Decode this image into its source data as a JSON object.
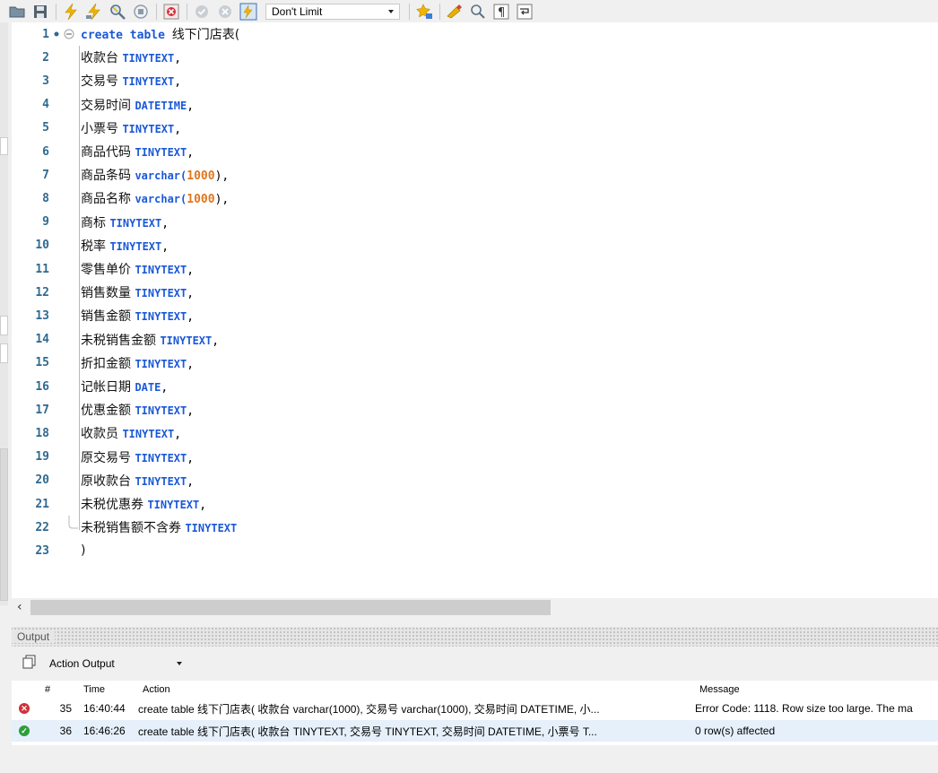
{
  "toolbar": {
    "limit_value": "Don't Limit",
    "icons": [
      "open-folder-icon",
      "save-icon",
      "execute-icon",
      "execute-current-icon",
      "explain-icon",
      "stop-icon",
      "toggle-error-icon",
      "commit-icon",
      "rollback-icon",
      "autocommit-icon",
      "beautify-icon",
      "snippet-icon",
      "find-icon",
      "invisible-chars-icon",
      "wrap-icon"
    ]
  },
  "editor": {
    "lines": [
      {
        "n": "1",
        "kw": "create table ",
        "id": "线下门店表(",
        "type": "",
        "num": "",
        "tail": ""
      },
      {
        "n": "2",
        "kw": "",
        "id": "收款台 ",
        "type": "TINYTEXT",
        "num": "",
        "tail": ","
      },
      {
        "n": "3",
        "kw": "",
        "id": "交易号 ",
        "type": "TINYTEXT",
        "num": "",
        "tail": ","
      },
      {
        "n": "4",
        "kw": "",
        "id": "交易时间 ",
        "type": "DATETIME",
        "num": "",
        "tail": ","
      },
      {
        "n": "5",
        "kw": "",
        "id": "小票号 ",
        "type": "TINYTEXT",
        "num": "",
        "tail": ","
      },
      {
        "n": "6",
        "kw": "",
        "id": "商品代码 ",
        "type": "TINYTEXT",
        "num": "",
        "tail": ","
      },
      {
        "n": "7",
        "kw": "",
        "id": "商品条码 ",
        "type": "varchar(",
        "num": "1000",
        "tail": "),"
      },
      {
        "n": "8",
        "kw": "",
        "id": "商品名称 ",
        "type": "varchar(",
        "num": "1000",
        "tail": "),"
      },
      {
        "n": "9",
        "kw": "",
        "id": "商标 ",
        "type": "TINYTEXT",
        "num": "",
        "tail": ","
      },
      {
        "n": "10",
        "kw": "",
        "id": "税率 ",
        "type": "TINYTEXT",
        "num": "",
        "tail": ","
      },
      {
        "n": "11",
        "kw": "",
        "id": "零售单价 ",
        "type": "TINYTEXT",
        "num": "",
        "tail": ","
      },
      {
        "n": "12",
        "kw": "",
        "id": "销售数量 ",
        "type": "TINYTEXT",
        "num": "",
        "tail": ","
      },
      {
        "n": "13",
        "kw": "",
        "id": "销售金额 ",
        "type": "TINYTEXT",
        "num": "",
        "tail": ","
      },
      {
        "n": "14",
        "kw": "",
        "id": "未税销售金额 ",
        "type": "TINYTEXT",
        "num": "",
        "tail": ","
      },
      {
        "n": "15",
        "kw": "",
        "id": "折扣金额 ",
        "type": "TINYTEXT",
        "num": "",
        "tail": ","
      },
      {
        "n": "16",
        "kw": "",
        "id": "记帐日期 ",
        "type": "DATE",
        "num": "",
        "tail": ","
      },
      {
        "n": "17",
        "kw": "",
        "id": "优惠金额 ",
        "type": "TINYTEXT",
        "num": "",
        "tail": ","
      },
      {
        "n": "18",
        "kw": "",
        "id": "收款员 ",
        "type": "TINYTEXT",
        "num": "",
        "tail": ","
      },
      {
        "n": "19",
        "kw": "",
        "id": "原交易号 ",
        "type": "TINYTEXT",
        "num": "",
        "tail": ","
      },
      {
        "n": "20",
        "kw": "",
        "id": "原收款台 ",
        "type": "TINYTEXT",
        "num": "",
        "tail": ","
      },
      {
        "n": "21",
        "kw": "",
        "id": "未税优惠券 ",
        "type": "TINYTEXT",
        "num": "",
        "tail": ","
      },
      {
        "n": "22",
        "kw": "",
        "id": "未税销售额不含券 ",
        "type": "TINYTEXT",
        "num": "",
        "tail": ""
      },
      {
        "n": "23",
        "kw": "",
        "id": ")",
        "type": "",
        "num": "",
        "tail": ""
      }
    ]
  },
  "output": {
    "title": "Output",
    "selector": "Action Output",
    "columns": {
      "num": "#",
      "time": "Time",
      "action": "Action",
      "message": "Message"
    },
    "rows": [
      {
        "status": "error",
        "num": "35",
        "time": "16:40:44",
        "action": "create table 线下门店表( 收款台 varchar(1000), 交易号 varchar(1000), 交易时间 DATETIME, 小...",
        "message": "Error Code: 1118. Row size too large. The ma"
      },
      {
        "status": "ok",
        "num": "36",
        "time": "16:46:26",
        "action": "create table 线下门店表( 收款台 TINYTEXT, 交易号 TINYTEXT, 交易时间 DATETIME, 小票号 T...",
        "message": "0 row(s) affected"
      }
    ]
  },
  "colors": {
    "error": "#d0303a",
    "ok": "#2e9e3a",
    "keyword": "#1a58d8",
    "number": "#e0761c",
    "line_number": "#2f6a90"
  }
}
